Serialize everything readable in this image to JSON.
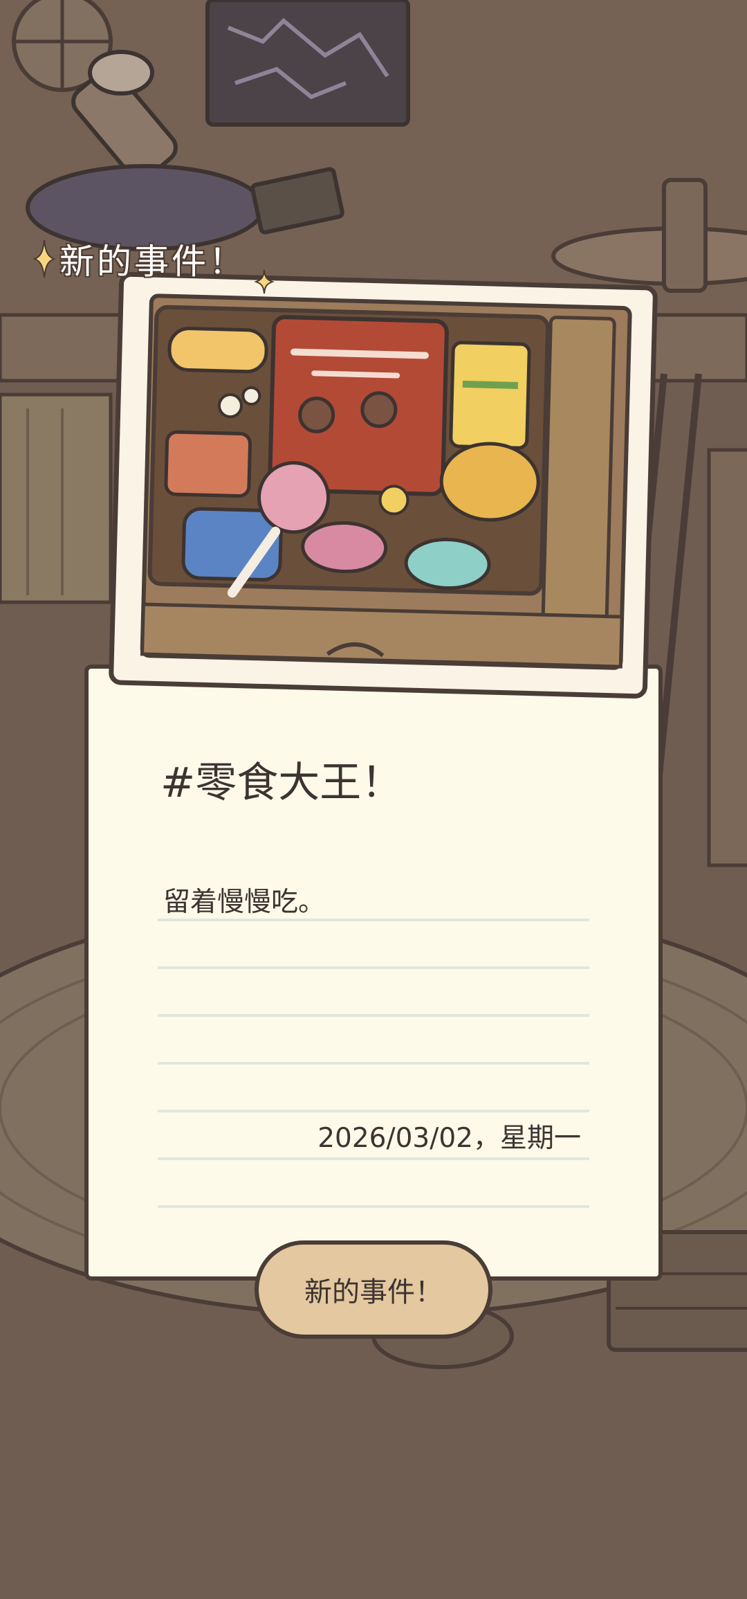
{
  "header": {
    "event_label": "新的事件！"
  },
  "card": {
    "title": "#零食大王！",
    "body": "留着慢慢吃。",
    "date": "2026/03/02，星期一"
  },
  "button": {
    "label": "新的事件！"
  },
  "colors": {
    "background": "#6f5d52",
    "paper": "#fdfaea",
    "button": "#e3c8a0",
    "outline": "#4a3c36",
    "sparkle": "#f6d77f",
    "snack_bag": "#b34a36"
  },
  "icons": {
    "header_sparkle": "sparkle-icon"
  }
}
